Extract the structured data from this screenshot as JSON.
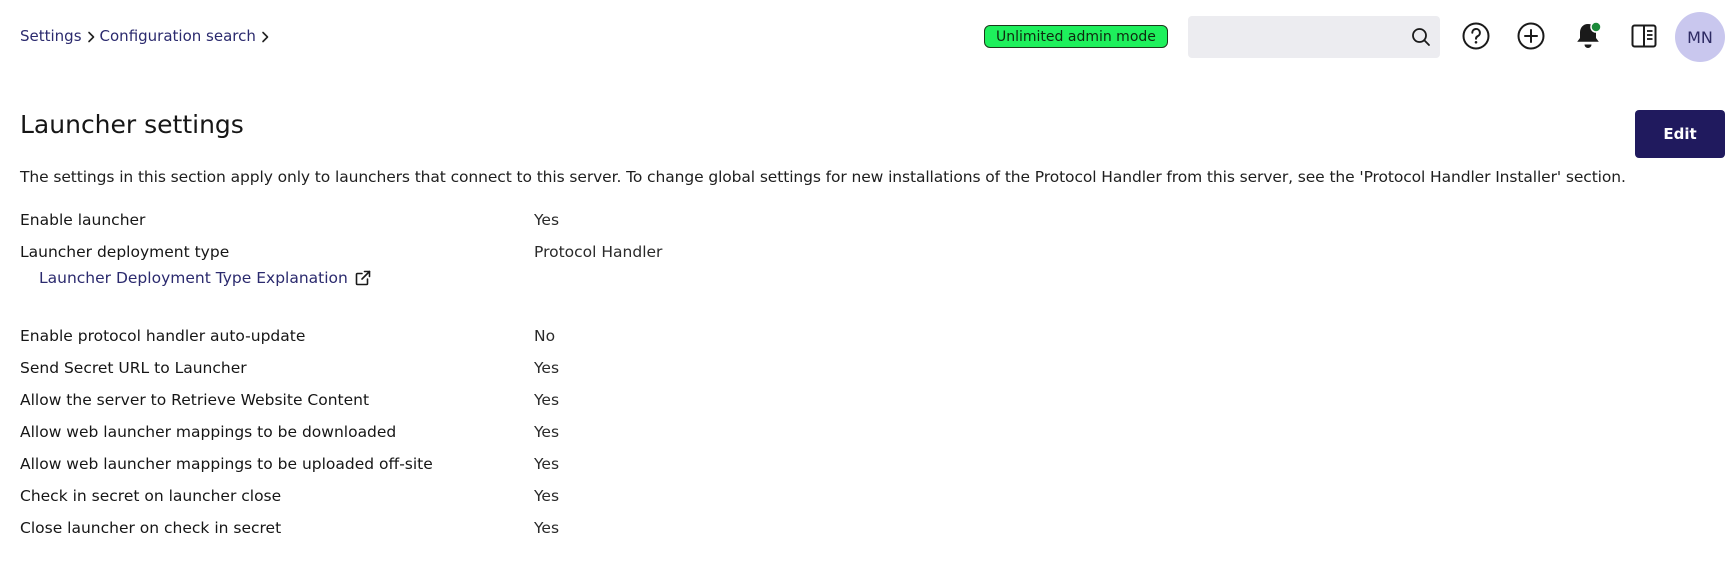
{
  "breadcrumb": {
    "items": [
      {
        "label": "Settings"
      },
      {
        "label": "Configuration search"
      }
    ]
  },
  "header": {
    "admin_badge": "Unlimited admin mode",
    "search": {
      "value": "",
      "placeholder": ""
    },
    "avatar_initials": "MN",
    "icons": [
      "help-icon",
      "add-icon",
      "bell-icon",
      "panel-toggle-icon"
    ],
    "badge_color": "#1ef05c",
    "notification_dot_color": "#1c8a3a"
  },
  "page": {
    "title": "Launcher settings",
    "edit_label": "Edit",
    "description": "The settings in this section apply only to launchers that connect to this server. To change global settings for new installations of the Protocol Handler from this server, see the 'Protocol Handler Installer' section.",
    "accent_color": "#201a5e"
  },
  "settings": [
    {
      "label": "Enable launcher",
      "value": "Yes"
    },
    {
      "label": "Launcher deployment type",
      "value": "Protocol Handler",
      "link": "Launcher Deployment Type Explanation"
    },
    {
      "label": "Enable protocol handler auto-update",
      "value": "No"
    },
    {
      "label": "Send Secret URL to Launcher",
      "value": "Yes"
    },
    {
      "label": "Allow the server to Retrieve Website Content",
      "value": "Yes"
    },
    {
      "label": "Allow web launcher mappings to be downloaded",
      "value": "Yes"
    },
    {
      "label": "Allow web launcher mappings to be uploaded off-site",
      "value": "Yes"
    },
    {
      "label": "Check in secret on launcher close",
      "value": "Yes"
    },
    {
      "label": "Close launcher on check in secret",
      "value": "Yes"
    }
  ]
}
